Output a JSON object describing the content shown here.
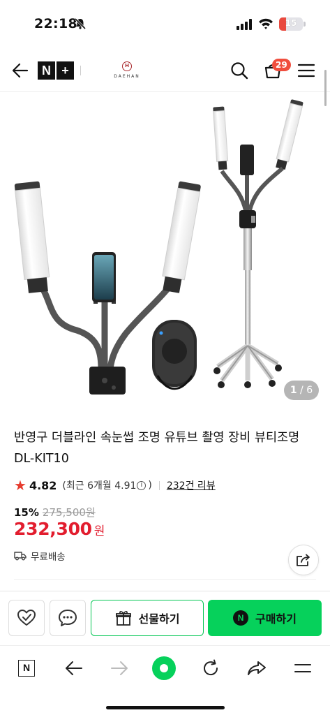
{
  "status_bar": {
    "time": "22:18",
    "battery": "15"
  },
  "header": {
    "n_plus_left": "N",
    "n_plus_right": "+",
    "brand_mark": "H",
    "brand_name": "DAEHAN",
    "cart_count": "29"
  },
  "gallery": {
    "current": "1",
    "separator": " / ",
    "total": "6"
  },
  "product": {
    "title": "반영구 더블라인 속눈썹 조명 유튜브 촬영 장비 뷰티조명 DL-KIT10",
    "rating": "4.82",
    "recent_rating_prefix": "(최근 6개월 4.91",
    "recent_rating_suffix": ")",
    "info_glyph": "i",
    "review_count": "232건 리뷰",
    "discount_pct": "15%",
    "original_price": "275,500원",
    "price": "232,300",
    "price_unit": "원",
    "shipping": "무료배송"
  },
  "buy_bar": {
    "gift_label": "선물하기",
    "buy_label": "구매하기",
    "buy_badge": "N"
  },
  "toolbar": {
    "n_label": "N"
  },
  "colors": {
    "price_red": "#e21d2e",
    "naver_green": "#06d15b",
    "badge_red": "#f04e3e",
    "star_red": "#e63b2e"
  },
  "icons": [
    "back-icon",
    "search-icon",
    "cart-icon",
    "menu-icon",
    "star-icon",
    "info-icon",
    "truck-icon",
    "share-icon",
    "heart-check-icon",
    "chat-icon",
    "gift-icon",
    "arrow-left-icon",
    "arrow-right-icon",
    "reload-icon",
    "forward-share-icon"
  ]
}
